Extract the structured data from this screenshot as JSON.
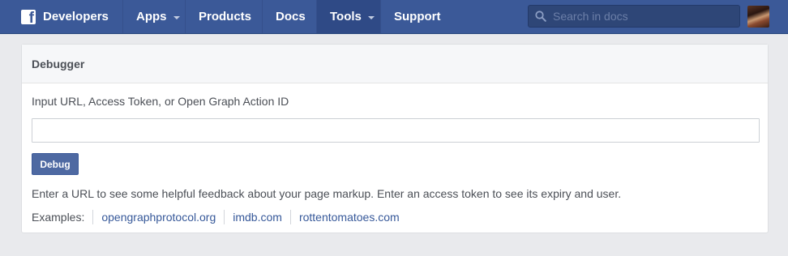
{
  "nav": {
    "brand_label": "Developers",
    "brand_icon": "facebook-f-icon",
    "items": [
      {
        "label": "Apps",
        "dropdown": true
      },
      {
        "label": "Products",
        "dropdown": false
      },
      {
        "label": "Docs",
        "dropdown": false
      },
      {
        "label": "Tools",
        "dropdown": true,
        "active": true
      },
      {
        "label": "Support",
        "dropdown": false
      }
    ],
    "search_placeholder": "Search in docs",
    "colors": {
      "bar": "#3b5998",
      "active": "#2f4a86"
    }
  },
  "debugger": {
    "title": "Debugger",
    "input_label": "Input URL, Access Token, or Open Graph Action ID",
    "input_value": "",
    "button_label": "Debug",
    "help_text": "Enter a URL to see some helpful feedback about your page markup. Enter an access token to see its expiry and user.",
    "examples_label": "Examples:",
    "examples": [
      "opengraphprotocol.org",
      "imdb.com",
      "rottentomatoes.com"
    ]
  }
}
